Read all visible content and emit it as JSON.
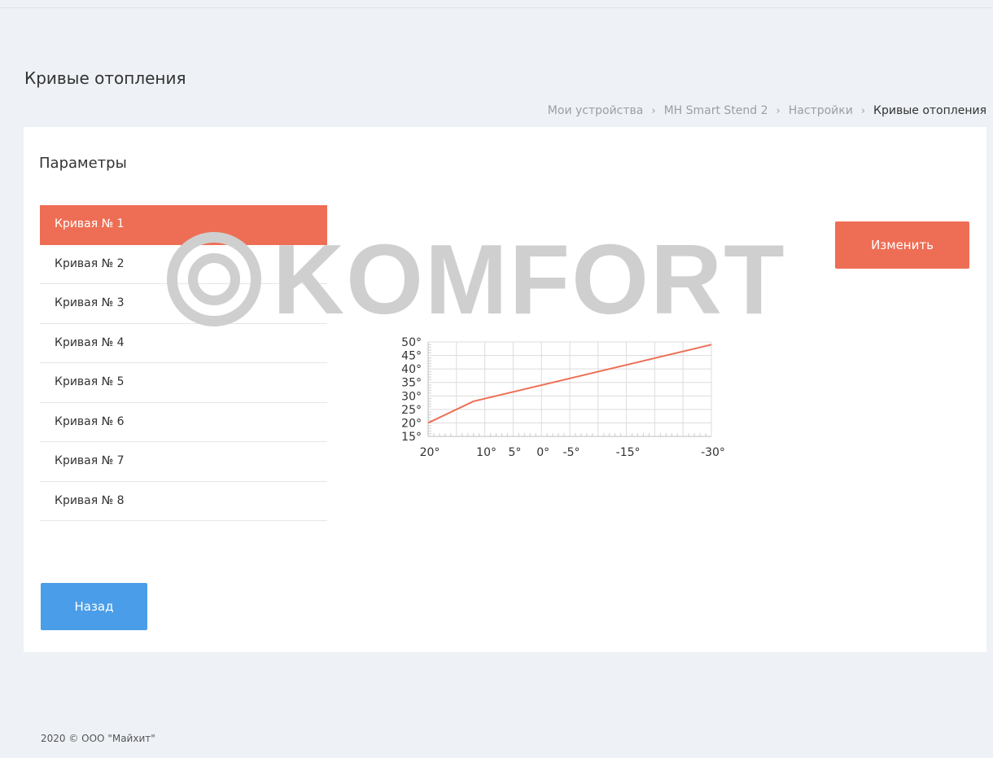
{
  "page": {
    "title": "Кривые отопления"
  },
  "breadcrumb": [
    {
      "label": "Мои устройства"
    },
    {
      "label": "MH Smart Stend 2"
    },
    {
      "label": "Настройки"
    },
    {
      "label": "Кривые отопления"
    }
  ],
  "breadcrumb_separator": "›",
  "params": {
    "title": "Параметры"
  },
  "curves": [
    {
      "label": "Кривая № 1",
      "active": true
    },
    {
      "label": "Кривая № 2",
      "active": false
    },
    {
      "label": "Кривая № 3",
      "active": false
    },
    {
      "label": "Кривая № 4",
      "active": false
    },
    {
      "label": "Кривая № 5",
      "active": false
    },
    {
      "label": "Кривая № 6",
      "active": false
    },
    {
      "label": "Кривая № 7",
      "active": false
    },
    {
      "label": "Кривая № 8",
      "active": false
    }
  ],
  "watermark": "KOMFORT",
  "buttons": {
    "change": "Изменить",
    "back": "Назад"
  },
  "footer": {
    "text": "2020 © ООО \"Майхит\""
  },
  "colors": {
    "accent": "#ee6e55",
    "primary": "#4a9de8",
    "background": "#eef1f5"
  },
  "chart_data": {
    "type": "line",
    "x": [
      20,
      12,
      -30
    ],
    "y": [
      20,
      28,
      49
    ],
    "xlim": [
      20,
      -30
    ],
    "ylim": [
      15,
      50
    ],
    "x_ticks": [
      20,
      10,
      5,
      0,
      -5,
      -15,
      -30
    ],
    "x_tick_labels": [
      "20°",
      "10°",
      "5°",
      "0°",
      "-5°",
      "-15°",
      "-30°"
    ],
    "y_ticks": [
      50,
      45,
      40,
      35,
      30,
      25,
      20,
      15
    ],
    "y_tick_labels": [
      "50°",
      "45°",
      "40°",
      "35°",
      "30°",
      "25°",
      "20°",
      "15°"
    ],
    "grid": true,
    "line_color": "#ee6e55"
  }
}
